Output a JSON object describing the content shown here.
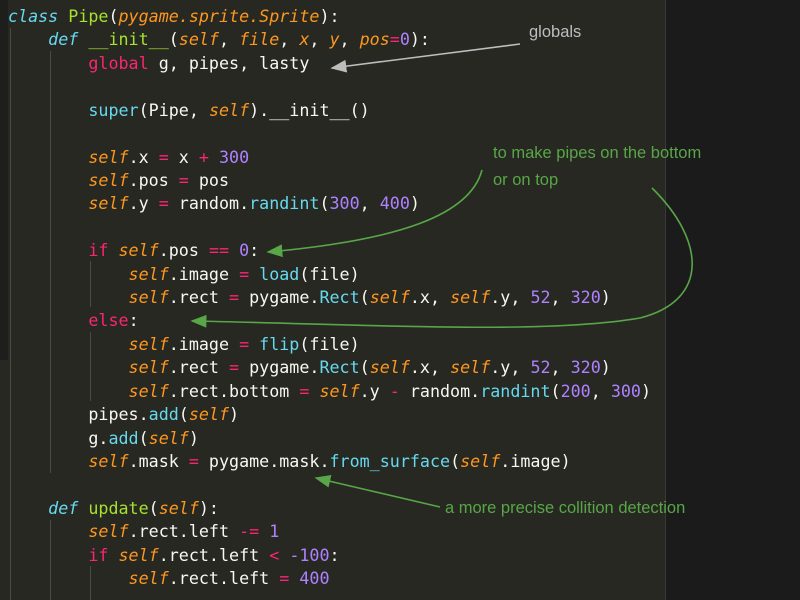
{
  "colors": {
    "background": "#272822",
    "keyword": "#66d9ef",
    "parameter": "#fd971f",
    "operator": "#f92672",
    "number": "#ae81ff",
    "class_name": "#a6e22e",
    "annotation_green": "#58a648",
    "annotation_gray": "#bdbdbd"
  },
  "code_lines": [
    [
      {
        "t": "class ",
        "c": "kw"
      },
      {
        "t": "Pipe",
        "c": "cls"
      },
      {
        "t": "(",
        "c": "pl"
      },
      {
        "t": "pygame.sprite.Sprite",
        "c": "it"
      },
      {
        "t": "):",
        "c": "pl"
      }
    ],
    [
      {
        "t": "    def ",
        "c": "kw"
      },
      {
        "t": "__init__",
        "c": "cls"
      },
      {
        "t": "(",
        "c": "pl"
      },
      {
        "t": "self",
        "c": "it"
      },
      {
        "t": ", ",
        "c": "pl"
      },
      {
        "t": "file",
        "c": "it"
      },
      {
        "t": ", ",
        "c": "pl"
      },
      {
        "t": "x",
        "c": "it"
      },
      {
        "t": ", ",
        "c": "pl"
      },
      {
        "t": "y",
        "c": "it"
      },
      {
        "t": ", ",
        "c": "pl"
      },
      {
        "t": "pos",
        "c": "it"
      },
      {
        "t": "=",
        "c": "pk"
      },
      {
        "t": "0",
        "c": "nm"
      },
      {
        "t": "):",
        "c": "pl"
      }
    ],
    [
      {
        "t": "        ",
        "c": "pl"
      },
      {
        "t": "global",
        "c": "pk"
      },
      {
        "t": " g, pipes, lasty",
        "c": "pl"
      }
    ],
    [],
    [
      {
        "t": "        super",
        "c": "fn"
      },
      {
        "t": "(Pipe, ",
        "c": "pl"
      },
      {
        "t": "self",
        "c": "it"
      },
      {
        "t": ").__init__()",
        "c": "pl"
      }
    ],
    [],
    [
      {
        "t": "        self",
        "c": "it"
      },
      {
        "t": ".x ",
        "c": "pl"
      },
      {
        "t": "=",
        "c": "pk"
      },
      {
        "t": " x ",
        "c": "pl"
      },
      {
        "t": "+",
        "c": "pk"
      },
      {
        "t": " ",
        "c": "pl"
      },
      {
        "t": "300",
        "c": "nm"
      }
    ],
    [
      {
        "t": "        self",
        "c": "it"
      },
      {
        "t": ".pos ",
        "c": "pl"
      },
      {
        "t": "=",
        "c": "pk"
      },
      {
        "t": " pos",
        "c": "pl"
      }
    ],
    [
      {
        "t": "        self",
        "c": "it"
      },
      {
        "t": ".y ",
        "c": "pl"
      },
      {
        "t": "=",
        "c": "pk"
      },
      {
        "t": " random.",
        "c": "pl"
      },
      {
        "t": "randint",
        "c": "fn"
      },
      {
        "t": "(",
        "c": "pl"
      },
      {
        "t": "300",
        "c": "nm"
      },
      {
        "t": ", ",
        "c": "pl"
      },
      {
        "t": "400",
        "c": "nm"
      },
      {
        "t": ")",
        "c": "pl"
      }
    ],
    [],
    [
      {
        "t": "        if ",
        "c": "pk"
      },
      {
        "t": "self",
        "c": "it"
      },
      {
        "t": ".pos ",
        "c": "pl"
      },
      {
        "t": "==",
        "c": "pk"
      },
      {
        "t": " ",
        "c": "pl"
      },
      {
        "t": "0",
        "c": "nm"
      },
      {
        "t": ":",
        "c": "pl"
      }
    ],
    [
      {
        "t": "            self",
        "c": "it"
      },
      {
        "t": ".image ",
        "c": "pl"
      },
      {
        "t": "=",
        "c": "pk"
      },
      {
        "t": " ",
        "c": "pl"
      },
      {
        "t": "load",
        "c": "fn"
      },
      {
        "t": "(file)",
        "c": "pl"
      }
    ],
    [
      {
        "t": "            self",
        "c": "it"
      },
      {
        "t": ".rect ",
        "c": "pl"
      },
      {
        "t": "=",
        "c": "pk"
      },
      {
        "t": " pygame.",
        "c": "pl"
      },
      {
        "t": "Rect",
        "c": "fn"
      },
      {
        "t": "(",
        "c": "pl"
      },
      {
        "t": "self",
        "c": "it"
      },
      {
        "t": ".x, ",
        "c": "pl"
      },
      {
        "t": "self",
        "c": "it"
      },
      {
        "t": ".y, ",
        "c": "pl"
      },
      {
        "t": "52",
        "c": "nm"
      },
      {
        "t": ", ",
        "c": "pl"
      },
      {
        "t": "320",
        "c": "nm"
      },
      {
        "t": ")",
        "c": "pl"
      }
    ],
    [
      {
        "t": "        else",
        "c": "pk"
      },
      {
        "t": ":",
        "c": "pl"
      }
    ],
    [
      {
        "t": "            self",
        "c": "it"
      },
      {
        "t": ".image ",
        "c": "pl"
      },
      {
        "t": "=",
        "c": "pk"
      },
      {
        "t": " ",
        "c": "pl"
      },
      {
        "t": "flip",
        "c": "fn"
      },
      {
        "t": "(file)",
        "c": "pl"
      }
    ],
    [
      {
        "t": "            self",
        "c": "it"
      },
      {
        "t": ".rect ",
        "c": "pl"
      },
      {
        "t": "=",
        "c": "pk"
      },
      {
        "t": " pygame.",
        "c": "pl"
      },
      {
        "t": "Rect",
        "c": "fn"
      },
      {
        "t": "(",
        "c": "pl"
      },
      {
        "t": "self",
        "c": "it"
      },
      {
        "t": ".x, ",
        "c": "pl"
      },
      {
        "t": "self",
        "c": "it"
      },
      {
        "t": ".y, ",
        "c": "pl"
      },
      {
        "t": "52",
        "c": "nm"
      },
      {
        "t": ", ",
        "c": "pl"
      },
      {
        "t": "320",
        "c": "nm"
      },
      {
        "t": ")",
        "c": "pl"
      }
    ],
    [
      {
        "t": "            self",
        "c": "it"
      },
      {
        "t": ".rect.bottom ",
        "c": "pl"
      },
      {
        "t": "=",
        "c": "pk"
      },
      {
        "t": " ",
        "c": "pl"
      },
      {
        "t": "self",
        "c": "it"
      },
      {
        "t": ".y ",
        "c": "pl"
      },
      {
        "t": "-",
        "c": "pk"
      },
      {
        "t": " random.",
        "c": "pl"
      },
      {
        "t": "randint",
        "c": "fn"
      },
      {
        "t": "(",
        "c": "pl"
      },
      {
        "t": "200",
        "c": "nm"
      },
      {
        "t": ", ",
        "c": "pl"
      },
      {
        "t": "300",
        "c": "nm"
      },
      {
        "t": ")",
        "c": "pl"
      }
    ],
    [
      {
        "t": "        pipes.",
        "c": "pl"
      },
      {
        "t": "add",
        "c": "fn"
      },
      {
        "t": "(",
        "c": "pl"
      },
      {
        "t": "self",
        "c": "it"
      },
      {
        "t": ")",
        "c": "pl"
      }
    ],
    [
      {
        "t": "        g.",
        "c": "pl"
      },
      {
        "t": "add",
        "c": "fn"
      },
      {
        "t": "(",
        "c": "pl"
      },
      {
        "t": "self",
        "c": "it"
      },
      {
        "t": ")",
        "c": "pl"
      }
    ],
    [
      {
        "t": "        self",
        "c": "it"
      },
      {
        "t": ".mask ",
        "c": "pl"
      },
      {
        "t": "=",
        "c": "pk"
      },
      {
        "t": " pygame.mask.",
        "c": "pl"
      },
      {
        "t": "from_surface",
        "c": "fn"
      },
      {
        "t": "(",
        "c": "pl"
      },
      {
        "t": "self",
        "c": "it"
      },
      {
        "t": ".image)",
        "c": "pl"
      }
    ],
    [],
    [
      {
        "t": "    def ",
        "c": "kw"
      },
      {
        "t": "update",
        "c": "cls"
      },
      {
        "t": "(",
        "c": "pl"
      },
      {
        "t": "self",
        "c": "it"
      },
      {
        "t": "):",
        "c": "pl"
      }
    ],
    [
      {
        "t": "        self",
        "c": "it"
      },
      {
        "t": ".rect.left ",
        "c": "pl"
      },
      {
        "t": "-=",
        "c": "pk"
      },
      {
        "t": " ",
        "c": "pl"
      },
      {
        "t": "1",
        "c": "nm"
      }
    ],
    [
      {
        "t": "        if ",
        "c": "pk"
      },
      {
        "t": "self",
        "c": "it"
      },
      {
        "t": ".rect.left ",
        "c": "pl"
      },
      {
        "t": "<",
        "c": "pk"
      },
      {
        "t": " ",
        "c": "pl"
      },
      {
        "t": "-100",
        "c": "nm"
      },
      {
        "t": ":",
        "c": "pl"
      }
    ],
    [
      {
        "t": "            self",
        "c": "it"
      },
      {
        "t": ".rect.left ",
        "c": "pl"
      },
      {
        "t": "=",
        "c": "pk"
      },
      {
        "t": " ",
        "c": "pl"
      },
      {
        "t": "400",
        "c": "nm"
      }
    ]
  ],
  "annotations": {
    "globals": "globals",
    "pipes_line1": "to make pipes on the bottom",
    "pipes_line2": "or on top",
    "collision": "a more precise collition detection"
  }
}
